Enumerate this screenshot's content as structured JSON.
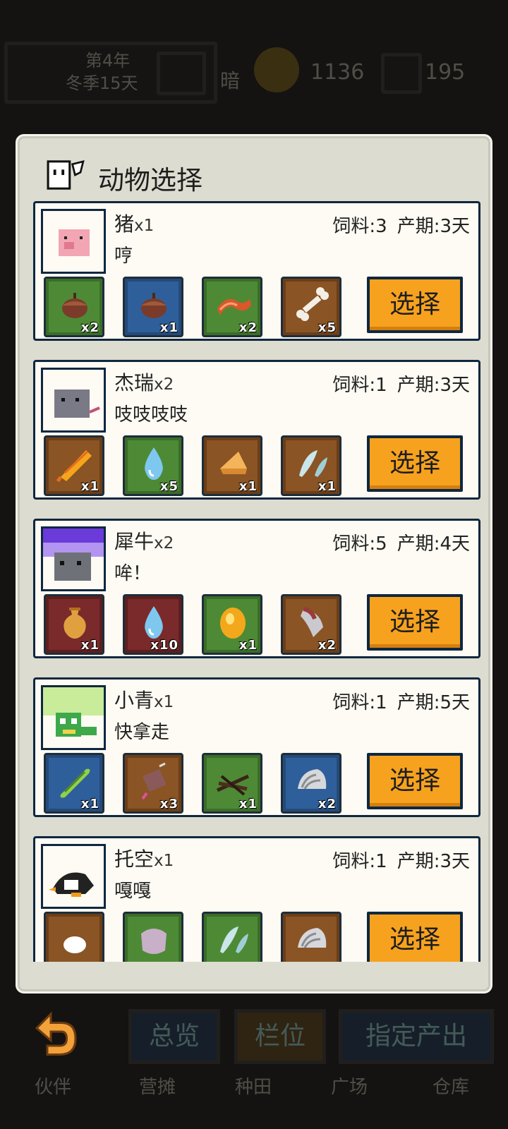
{
  "background": {
    "year": "第4年",
    "season_day": "冬季15天",
    "light": "暗",
    "coins": "1136",
    "gems": "195",
    "tabs": [
      "总览",
      "栏位",
      "指定产出"
    ],
    "nav": [
      "伙伴",
      "营摊",
      "种田",
      "广场",
      "仓库"
    ]
  },
  "dialog": {
    "title": "动物选择",
    "select_label": "选择",
    "feed_prefix": "饲料:",
    "period_prefix": "产期:",
    "animals": [
      {
        "name": "猪",
        "count": "x1",
        "desc": "哼",
        "feed": "3",
        "period": "3天",
        "avatar": "pig-icon",
        "items": [
          {
            "icon": "nut-icon",
            "color": "green",
            "qty": "x2"
          },
          {
            "icon": "nut-icon",
            "color": "blue",
            "qty": "x1"
          },
          {
            "icon": "bacon-icon",
            "color": "green",
            "qty": "x2"
          },
          {
            "icon": "bone-icon",
            "color": "brown",
            "qty": "x5"
          }
        ]
      },
      {
        "name": "杰瑞",
        "count": "x2",
        "desc": "吱吱吱吱",
        "feed": "1",
        "period": "3天",
        "avatar": "mouse-icon",
        "items": [
          {
            "icon": "corn-icon",
            "color": "brown",
            "qty": "x1"
          },
          {
            "icon": "water-drop-icon",
            "color": "green",
            "qty": "x5"
          },
          {
            "icon": "cheese-icon",
            "color": "brown",
            "qty": "x1"
          },
          {
            "icon": "feather-icon",
            "color": "brown",
            "qty": "x1"
          }
        ]
      },
      {
        "name": "犀牛",
        "count": "x2",
        "desc": "哞！",
        "feed": "5",
        "period": "4天",
        "avatar": "rhino-icon",
        "items": [
          {
            "icon": "vase-icon",
            "color": "red",
            "qty": "x1"
          },
          {
            "icon": "water-drop-icon",
            "color": "red",
            "qty": "x10"
          },
          {
            "icon": "golden-egg-icon",
            "color": "green",
            "qty": "x1"
          },
          {
            "icon": "horn-icon",
            "color": "brown",
            "qty": "x2"
          }
        ]
      },
      {
        "name": "小青",
        "count": "x1",
        "desc": "快拿走",
        "feed": "1",
        "period": "5天",
        "avatar": "snake-icon",
        "items": [
          {
            "icon": "cucumber-icon",
            "color": "blue",
            "qty": "x1"
          },
          {
            "icon": "meat-skewer-icon",
            "color": "brown",
            "qty": "x3"
          },
          {
            "icon": "twigs-icon",
            "color": "green",
            "qty": "x1"
          },
          {
            "icon": "shell-icon",
            "color": "blue",
            "qty": "x2"
          }
        ]
      },
      {
        "name": "托空",
        "count": "x1",
        "desc": "嘎嘎",
        "feed": "1",
        "period": "3天",
        "avatar": "penguin-icon",
        "items": [
          {
            "icon": "egg-icon",
            "color": "brown",
            "qty": ""
          },
          {
            "icon": "cloth-icon",
            "color": "green",
            "qty": ""
          },
          {
            "icon": "feather-icon",
            "color": "green",
            "qty": ""
          },
          {
            "icon": "shell-icon",
            "color": "brown",
            "qty": ""
          }
        ]
      }
    ]
  }
}
